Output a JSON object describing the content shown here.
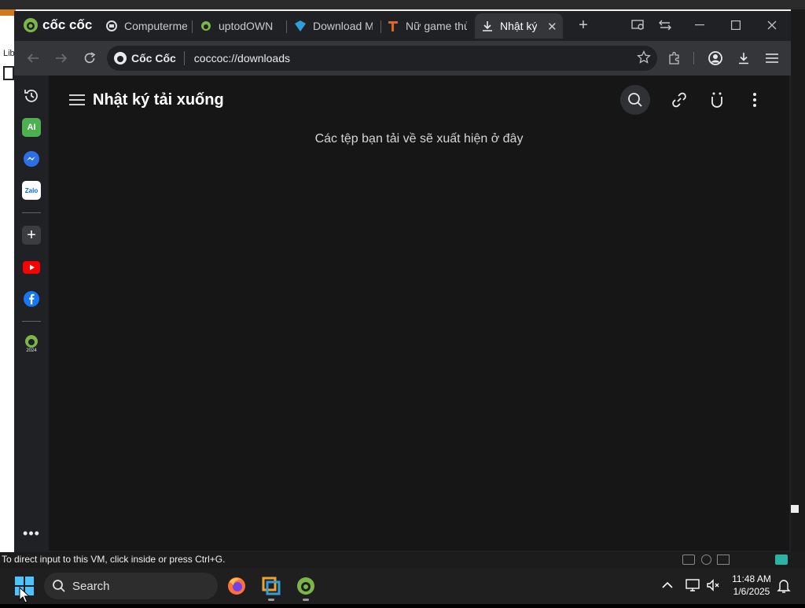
{
  "vm": {
    "side_label": "Lib",
    "status_text": "To direct input to this VM, click inside or press Ctrl+G."
  },
  "browser": {
    "brand": "cốc cốc",
    "tabs": [
      {
        "label": "Computerme",
        "icon": "computer-tab-icon"
      },
      {
        "label": "uptodOWN",
        "icon": "uptodown-tab-icon"
      },
      {
        "label": "Download M",
        "icon": "download-tab-icon"
      },
      {
        "label": "Nữ game thủ",
        "icon": "game-tab-icon"
      },
      {
        "label": "Nhật ký",
        "icon": "download-history-tab-icon",
        "active": true
      }
    ],
    "omnibox": {
      "brand": "Cốc Cốc",
      "url": "coccoc://downloads"
    },
    "colors": {
      "tab_bg": "#202124",
      "toolbar_bg": "#35363a",
      "page_bg": "#161616",
      "accent_green": "#7ab648"
    }
  },
  "sidebar": {
    "items": [
      "history-icon",
      "ai-icon",
      "messenger-icon",
      "zalo-icon",
      "add-icon",
      "youtube-icon",
      "facebook-icon",
      "coccoc-2024-icon",
      "more-icon"
    ],
    "ai_label": "AI",
    "zalo_label": "Zalo",
    "year_label": "2024"
  },
  "page": {
    "title": "Nhật ký tải xuống",
    "empty_message": "Các tệp bạn tải về sẽ xuất hiện ở đây"
  },
  "taskbar": {
    "search_label": "Search",
    "time": "11:48 AM",
    "date": "1/6/2025"
  }
}
